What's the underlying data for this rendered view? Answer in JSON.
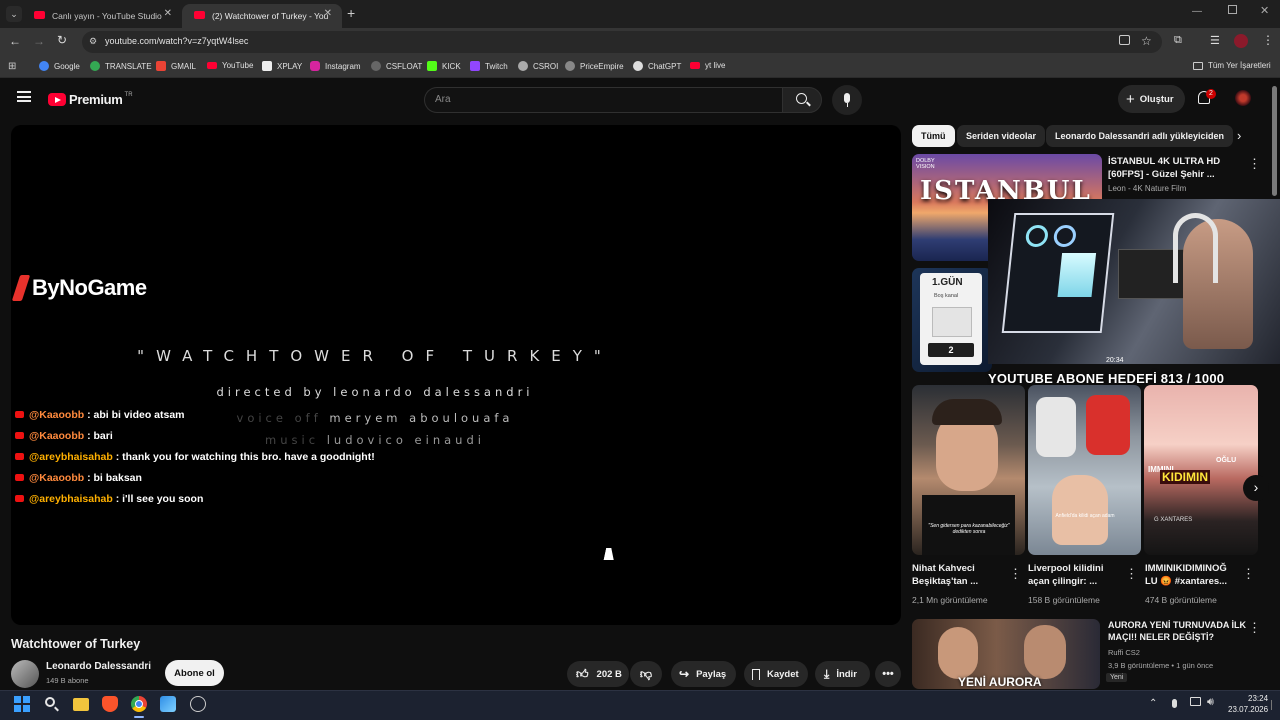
{
  "browser": {
    "tabs": [
      {
        "title": "Canlı yayın - YouTube Studio"
      },
      {
        "title": "(2) Watchtower of Turkey - You"
      }
    ],
    "url": "youtube.com/watch?v=z7yqtW4lsec",
    "bookmarks": [
      "Google",
      "TRANSLATE",
      "GMAIL",
      "YouTube",
      "XPLAY",
      "Instagram",
      "CSFLOAT",
      "KICK",
      "Twitch",
      "CSROI",
      "PriceEmpire",
      "ChatGPT",
      "yt live"
    ],
    "all_bookmarks": "Tüm Yer İşaretleri"
  },
  "masthead": {
    "logo": "Premium",
    "logo_region": "TR",
    "search_placeholder": "Ara",
    "create_label": "Oluştur",
    "notification_count": "2"
  },
  "player": {
    "brand": "ByNoGame",
    "film_title": "\"WATCHTOWER OF TURKEY\"",
    "directed_prefix": "directed by",
    "director": "leonardo dalessandri",
    "voice_prefix": "voice off",
    "voice": "meryem aboulouafa",
    "music_prefix": "music",
    "music": "ludovico einaudi",
    "chat": [
      {
        "user": "@Kaaoobb",
        "text": ": abi bi video atsam"
      },
      {
        "user": "@Kaaoobb",
        "text": ": bari"
      },
      {
        "user": "@areybhaisahab",
        "text": ": thank you for watching this bro. have a goodnight!"
      },
      {
        "user": "@Kaaoobb",
        "text": ": bi baksan"
      },
      {
        "user": "@areybhaisahab",
        "text": ": i'll see you soon"
      }
    ]
  },
  "video": {
    "title": "Watchtower of Turkey",
    "channel": "Leonardo Dalessandri",
    "subscribers": "149 B abone",
    "subscribe_label": "Abone ol",
    "likes": "202 B",
    "share_label": "Paylaş",
    "save_label": "Kaydet",
    "download_label": "İndir"
  },
  "sidebar": {
    "chips": [
      "Tümü",
      "Seriden videolar",
      "Leonardo Dalessandri adlı yükleyiciden"
    ],
    "first": {
      "title_line1": "İSTANBUL 4K ULTRA HD",
      "title_line2": "[60FPS] - Güzel Şehir ...",
      "channel": "Leon - 4K Nature Film",
      "thumb_text": "ISTANBUL",
      "badge_line1": "DOLBY",
      "badge_line2": "VISION"
    },
    "second": {
      "thumb_day": "1.GÜN",
      "thumb_label": "Boş kanal",
      "thumb_num": "2"
    },
    "overlay_goal": "YOUTUBE ABONE HEDEFİ 813 / 1000",
    "overlay_time": "20:34",
    "shorts": [
      {
        "title_line1": "Nihat Kahveci",
        "title_line2": "Beşiktaş'tan ...",
        "views": "2,1 Mn görüntüleme",
        "caption": "\"Sen gidersen para kazanabileceğiz\" dedikten sonra"
      },
      {
        "title_line1": "Liverpool kilidini",
        "title_line2": "açan çilingir: ...",
        "views": "158 B görüntüleme",
        "caption": "Anfield'da kilidi açan adam"
      },
      {
        "title_line1": "IMMINIKIDIMINOĞ",
        "title_line2": "LU 😡 #xantares...",
        "views": "474 B görüntüleme",
        "thumb_top": "OĞLU",
        "thumb_big": "KIDIMIN",
        "thumb_small": "IMMINI",
        "thumb_bottom": "G XANTARES"
      }
    ],
    "last": {
      "title_line1": "AURORA YENİ TURNUVADA İLK",
      "title_line2": "MAÇI!! NELER DEĞİŞTİ?",
      "channel": "Ruffi CS2",
      "meta": "3,9 B görüntüleme • 1 gün önce",
      "badge": "Yeni",
      "thumb_text": "YENİ AURORA"
    }
  },
  "taskbar": {
    "time": "23:24",
    "date": "23.07.2026"
  }
}
